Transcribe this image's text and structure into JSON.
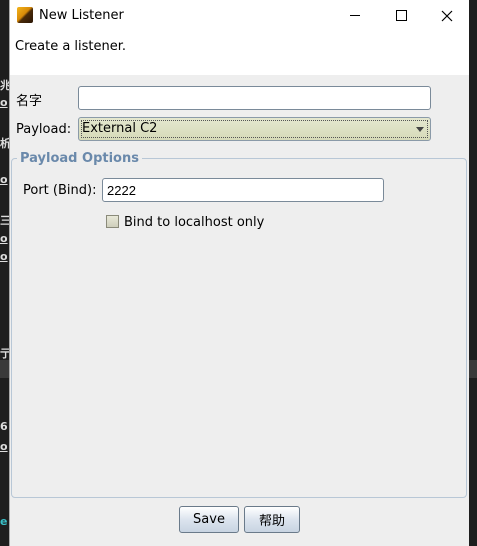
{
  "window": {
    "title": "New Listener",
    "description": "Create a listener."
  },
  "form": {
    "name_label": "名字",
    "name_value": "",
    "payload_label": "Payload:",
    "payload_value": "External C2"
  },
  "payload_options": {
    "title": "Payload Options",
    "port_label": "Port (Bind):",
    "port_value": "2222",
    "bind_localhost_label": "Bind to localhost only",
    "bind_localhost_checked": false
  },
  "buttons": {
    "save": "Save",
    "help": "帮助"
  },
  "background_fragments": [
    "兆",
    "o",
    "析",
    "o",
    "三",
    "o",
    "o",
    "亍",
    "6",
    "o",
    "e"
  ]
}
